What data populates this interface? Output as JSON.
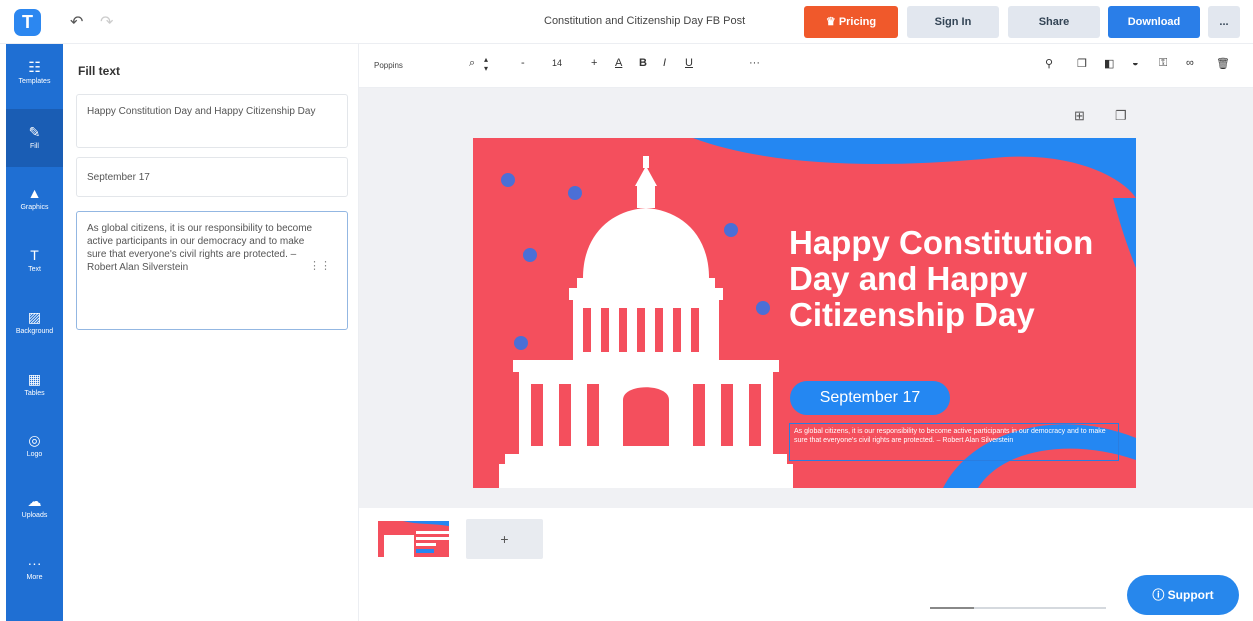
{
  "header": {
    "logo_letter": "T",
    "undo_icon": "undo-icon",
    "redo_icon": "redo-icon",
    "doc_title": "Constitution and Citizenship Day FB Post",
    "pricing": "Pricing",
    "signin": "Sign In",
    "share": "Share",
    "download": "Download",
    "more": "..."
  },
  "sidebar": {
    "items": [
      {
        "label": "Templates",
        "icon": "templates-icon",
        "glyph": "☷"
      },
      {
        "label": "Fill",
        "icon": "pen-icon",
        "glyph": "✎"
      },
      {
        "label": "Graphics",
        "icon": "shapes-icon",
        "glyph": "▲"
      },
      {
        "label": "Text",
        "icon": "text-icon",
        "glyph": "T"
      },
      {
        "label": "Background",
        "icon": "background-icon",
        "glyph": "▨"
      },
      {
        "label": "Tables",
        "icon": "table-icon",
        "glyph": "▦"
      },
      {
        "label": "Logo",
        "icon": "logo-icon",
        "glyph": "◎"
      },
      {
        "label": "Uploads",
        "icon": "cloud-upload-icon",
        "glyph": "☁"
      },
      {
        "label": "More",
        "icon": "more-icon",
        "glyph": "···"
      }
    ]
  },
  "panel": {
    "title": "Fill text",
    "fields": [
      "Happy Constitution Day and Happy Citizenship Day",
      "September 17",
      "As global citizens, it is our responsibility to become active participants in our democracy and to make sure that everyone's civil rights are protected. – Robert Alan Silverstein"
    ],
    "collapse_glyph": "‹"
  },
  "toolbar": {
    "font_family": "Poppins",
    "font_size": "14",
    "minus": "-",
    "plus": "+",
    "more": "···"
  },
  "canvas": {
    "headline": "Happy Constitution Day and Happy Citizenship Day",
    "date": "September 17",
    "quote": "As global citizens, it is our responsibility to become active participants in our democracy and to make sure that everyone's civil rights are protected. – Robert Alan Silverstein"
  },
  "pages": {
    "add_label": "+"
  },
  "zoom": {
    "level": 0.25
  },
  "support": {
    "label": "Support"
  },
  "colors": {
    "brand_blue": "#2c87f0",
    "poster_red": "#f44f5d",
    "pricing_orange": "#f0592b"
  }
}
